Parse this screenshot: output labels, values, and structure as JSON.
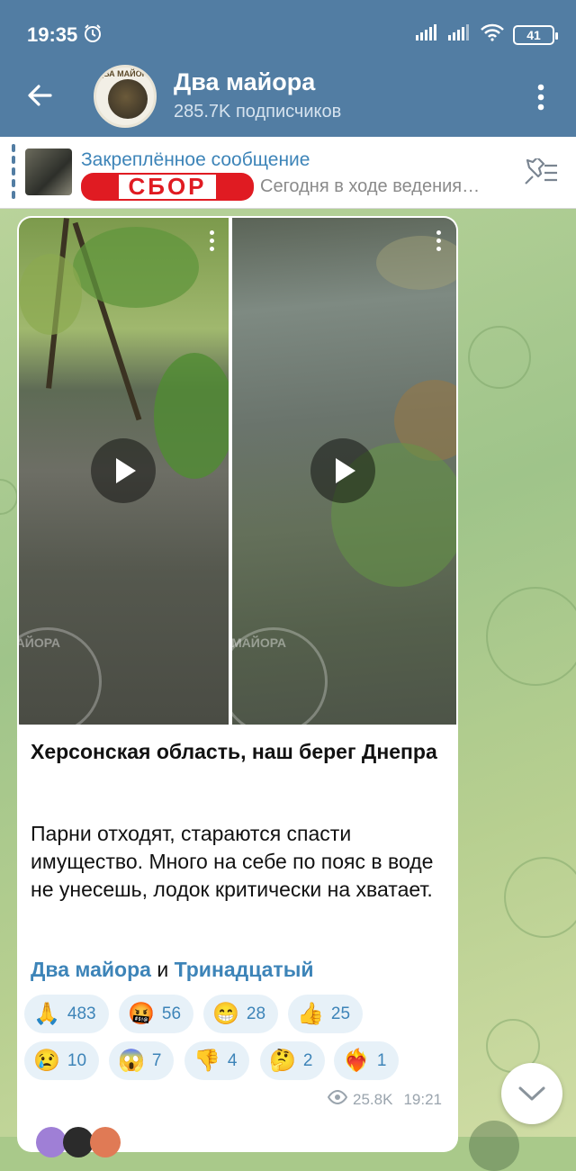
{
  "status_bar": {
    "time": "19:35",
    "battery": "41"
  },
  "header": {
    "title": "Два майора",
    "subscribers": "285.7K подписчиков",
    "avatar_text": "ДВА МАЙОРА"
  },
  "pinned": {
    "title": "Закреплённое сообщение",
    "badge": "СБОР",
    "preview": "Сегодня в ходе ведения…"
  },
  "message": {
    "title": "Херсонская область, наш берег Днепра",
    "body": "Парни отходят, стараются спасти имущество. Много на себе по пояс в воде не унесешь, лодок критически на хватает.",
    "author_link": "Два майора",
    "conjunction": "и",
    "second_link": "Тринадцатый",
    "watermark": "МАЙОРА",
    "reactions": [
      {
        "emoji": "🙏",
        "count": "483"
      },
      {
        "emoji": "🤬",
        "count": "56"
      },
      {
        "emoji": "😁",
        "count": "28"
      },
      {
        "emoji": "👍",
        "count": "25"
      },
      {
        "emoji": "😢",
        "count": "10"
      },
      {
        "emoji": "😱",
        "count": "7"
      },
      {
        "emoji": "👎",
        "count": "4"
      },
      {
        "emoji": "🤔",
        "count": "2"
      },
      {
        "emoji": "❤️‍🔥",
        "count": "1"
      }
    ],
    "views": "25.8K",
    "time": "19:21"
  },
  "colors": {
    "header_bg": "#527da3",
    "accent": "#3d84b8",
    "badge_red": "#e01b22",
    "reaction_bg": "#e7f1f8"
  }
}
